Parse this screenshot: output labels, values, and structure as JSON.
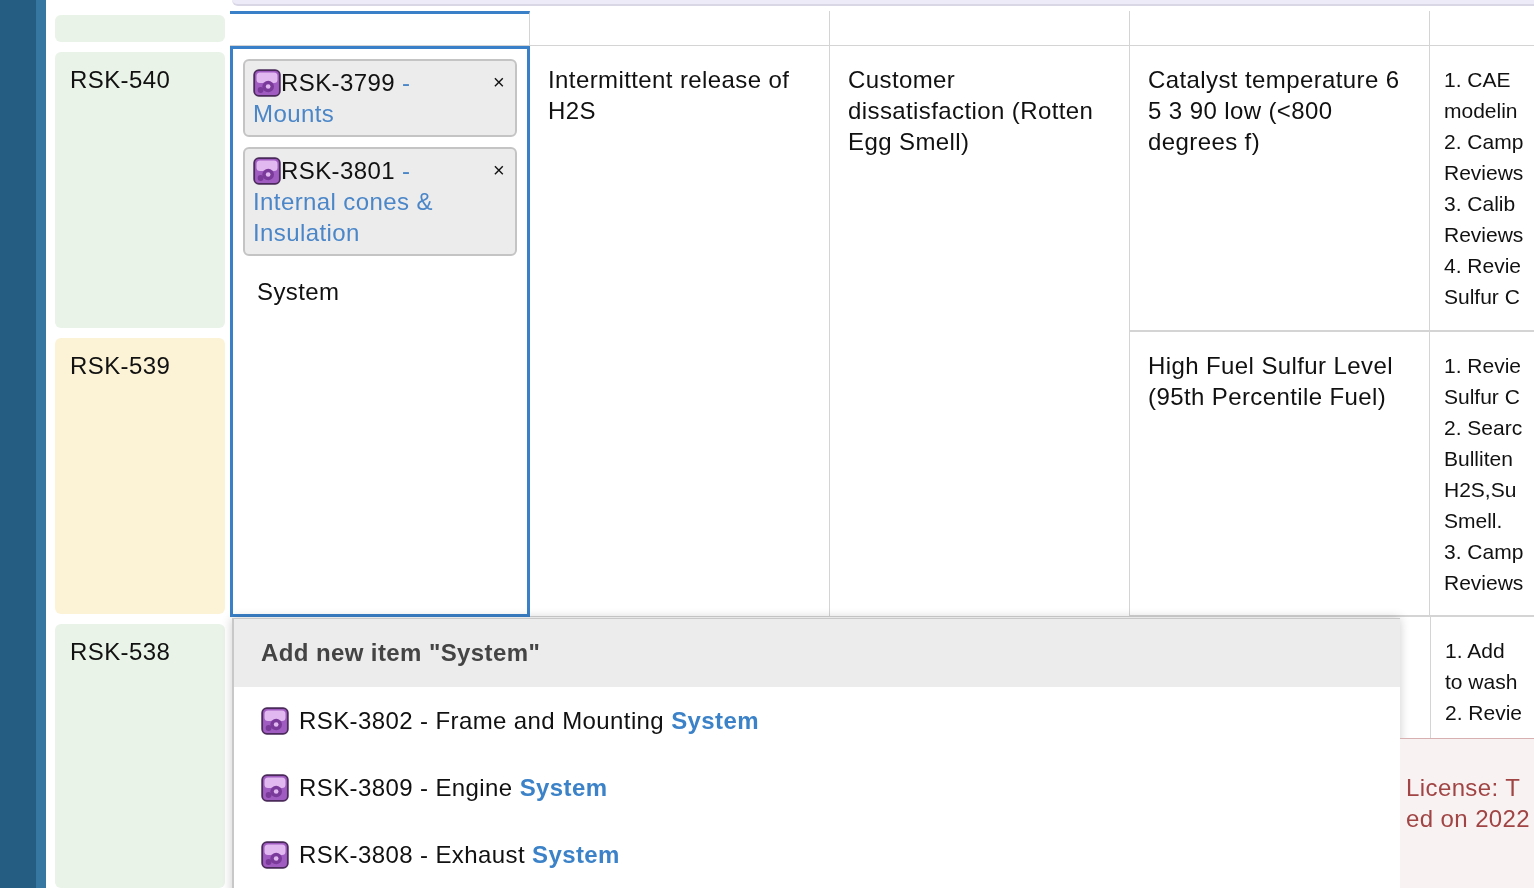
{
  "keys": [
    {
      "color": "#e9f3e8"
    },
    {
      "label": "RSK-540",
      "color": "#e9f3e8"
    },
    {
      "label": "RSK-539",
      "color": "#fcf3d6"
    },
    {
      "label": "RSK-538",
      "color": "#e9f3e8"
    }
  ],
  "editor": {
    "chips": [
      {
        "id": "RSK-3799",
        "separator": "-",
        "title": "Mounts",
        "remove": "×"
      },
      {
        "id": "RSK-3801",
        "separator": "-",
        "title": "Internal cones & Insulation",
        "remove": "×"
      }
    ],
    "value": "System"
  },
  "failure": "Intermittent release of H2S",
  "effect": "Customer dissatisfaction (Rotten Egg Smell)",
  "causes": [
    {
      "text": "Catalyst temperature 6 5 3 90 low (<800 degrees f)",
      "actions": [
        "1. CAE",
        "modelin",
        "2. Camp",
        "Reviews",
        "3. Calib",
        "Reviews",
        "4. Revie",
        "Sulfur C"
      ]
    },
    {
      "text": "High Fuel Sulfur Level (95th Percentile Fuel)",
      "actions": [
        "1. Revie",
        "Sulfur C",
        "2. Searc",
        "Bulliten",
        "H2S,Su",
        "Smell.",
        "3. Camp",
        "Reviews"
      ]
    }
  ],
  "next_row_actions": [
    "1. Add",
    "to wash",
    "2. Revie"
  ],
  "dropdown": {
    "create_label": "Add new item \"System\"",
    "options": [
      {
        "label": "RSK-3802 - Frame and Mounting **System**"
      },
      {
        "label": "RSK-3809 - Engine **System**"
      },
      {
        "label": "RSK-3808 - Exhaust **System**"
      }
    ]
  },
  "license": {
    "lines": [
      "License: T",
      "ed on 2022"
    ]
  }
}
